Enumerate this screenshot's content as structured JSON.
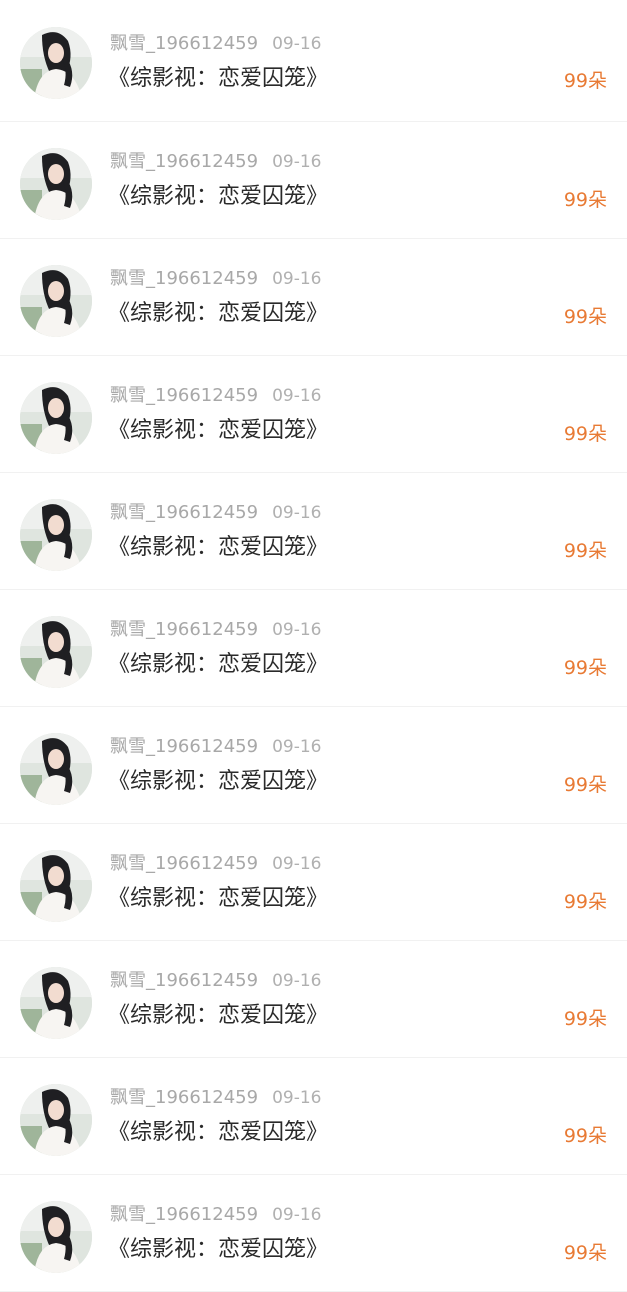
{
  "items": [
    {
      "username": "飘雪_196612459",
      "date": "09-16",
      "title": "《综影视：恋爱囚笼》",
      "count": "99朵"
    },
    {
      "username": "飘雪_196612459",
      "date": "09-16",
      "title": "《综影视：恋爱囚笼》",
      "count": "99朵"
    },
    {
      "username": "飘雪_196612459",
      "date": "09-16",
      "title": "《综影视：恋爱囚笼》",
      "count": "99朵"
    },
    {
      "username": "飘雪_196612459",
      "date": "09-16",
      "title": "《综影视：恋爱囚笼》",
      "count": "99朵"
    },
    {
      "username": "飘雪_196612459",
      "date": "09-16",
      "title": "《综影视：恋爱囚笼》",
      "count": "99朵"
    },
    {
      "username": "飘雪_196612459",
      "date": "09-16",
      "title": "《综影视：恋爱囚笼》",
      "count": "99朵"
    },
    {
      "username": "飘雪_196612459",
      "date": "09-16",
      "title": "《综影视：恋爱囚笼》",
      "count": "99朵"
    },
    {
      "username": "飘雪_196612459",
      "date": "09-16",
      "title": "《综影视：恋爱囚笼》",
      "count": "99朵"
    },
    {
      "username": "飘雪_196612459",
      "date": "09-16",
      "title": "《综影视：恋爱囚笼》",
      "count": "99朵"
    },
    {
      "username": "飘雪_196612459",
      "date": "09-16",
      "title": "《综影视：恋爱囚笼》",
      "count": "99朵"
    },
    {
      "username": "飘雪_196612459",
      "date": "09-16",
      "title": "《综影视：恋爱囚笼》",
      "count": "99朵"
    }
  ],
  "colors": {
    "count_accent": "#e87a34",
    "meta_gray": "#a8a8a8",
    "title_text": "#2a2a2a"
  },
  "avatar_icon": "user-avatar-photo"
}
